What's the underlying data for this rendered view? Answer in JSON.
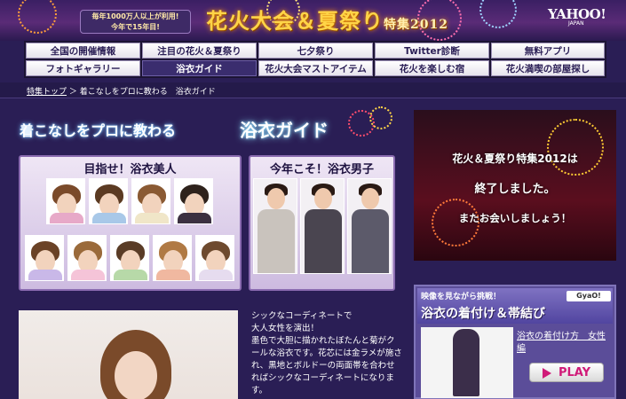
{
  "header": {
    "tagline_line1": "毎年1000万人以上が利用!",
    "tagline_line2": "今年で15年目!",
    "title_main": "花火大会＆夏祭り",
    "title_sub": "特集2012",
    "logo_text": "YAHOO!",
    "logo_sub": "JAPAN"
  },
  "nav": {
    "row1": [
      "全国の開催情報",
      "注目の花火＆夏祭り",
      "七夕祭り",
      "Twitter診断",
      "無料アプリ"
    ],
    "row2": [
      "フォトギャラリー",
      "浴衣ガイド",
      "花火大会マストアイテム",
      "花火を楽しむ宿",
      "花火満喫の部屋探し"
    ],
    "active": "浴衣ガイド"
  },
  "breadcrumb": {
    "home": "特集トップ",
    "separator": "＞",
    "current": "着こなしをプロに教わる　浴衣ガイド"
  },
  "hero": {
    "main": "着こなしをプロに教わる",
    "guide": "浴衣ガイド"
  },
  "panels": {
    "women_title": "目指せ！浴衣美人",
    "men_title": "今年こそ！浴衣男子"
  },
  "ended": {
    "line1": "花火＆夏祭り特集2012は",
    "line2": "終了しました。",
    "line3": "またお会いしましょう！"
  },
  "video": {
    "intro": "映像を見ながら挑戦！",
    "title": "浴衣の着付け＆帯結び",
    "gyao": "GyaO!",
    "link_text": "浴衣の着付け方　女性編",
    "play_label": "PLAY"
  },
  "description": {
    "line1": "シックなコーディネートで",
    "line2": "大人女性を演出！",
    "body": "墨色で大胆に描かれたぼたんと菊がクールな浴衣です。花芯には金ラメが施され、黒地とボルドーの両面帯を合わせればシックなコーディネートになります。"
  },
  "colors": {
    "background": "#2a1e55",
    "title_gold": "#ffd447",
    "play_pink": "#d01a78"
  }
}
